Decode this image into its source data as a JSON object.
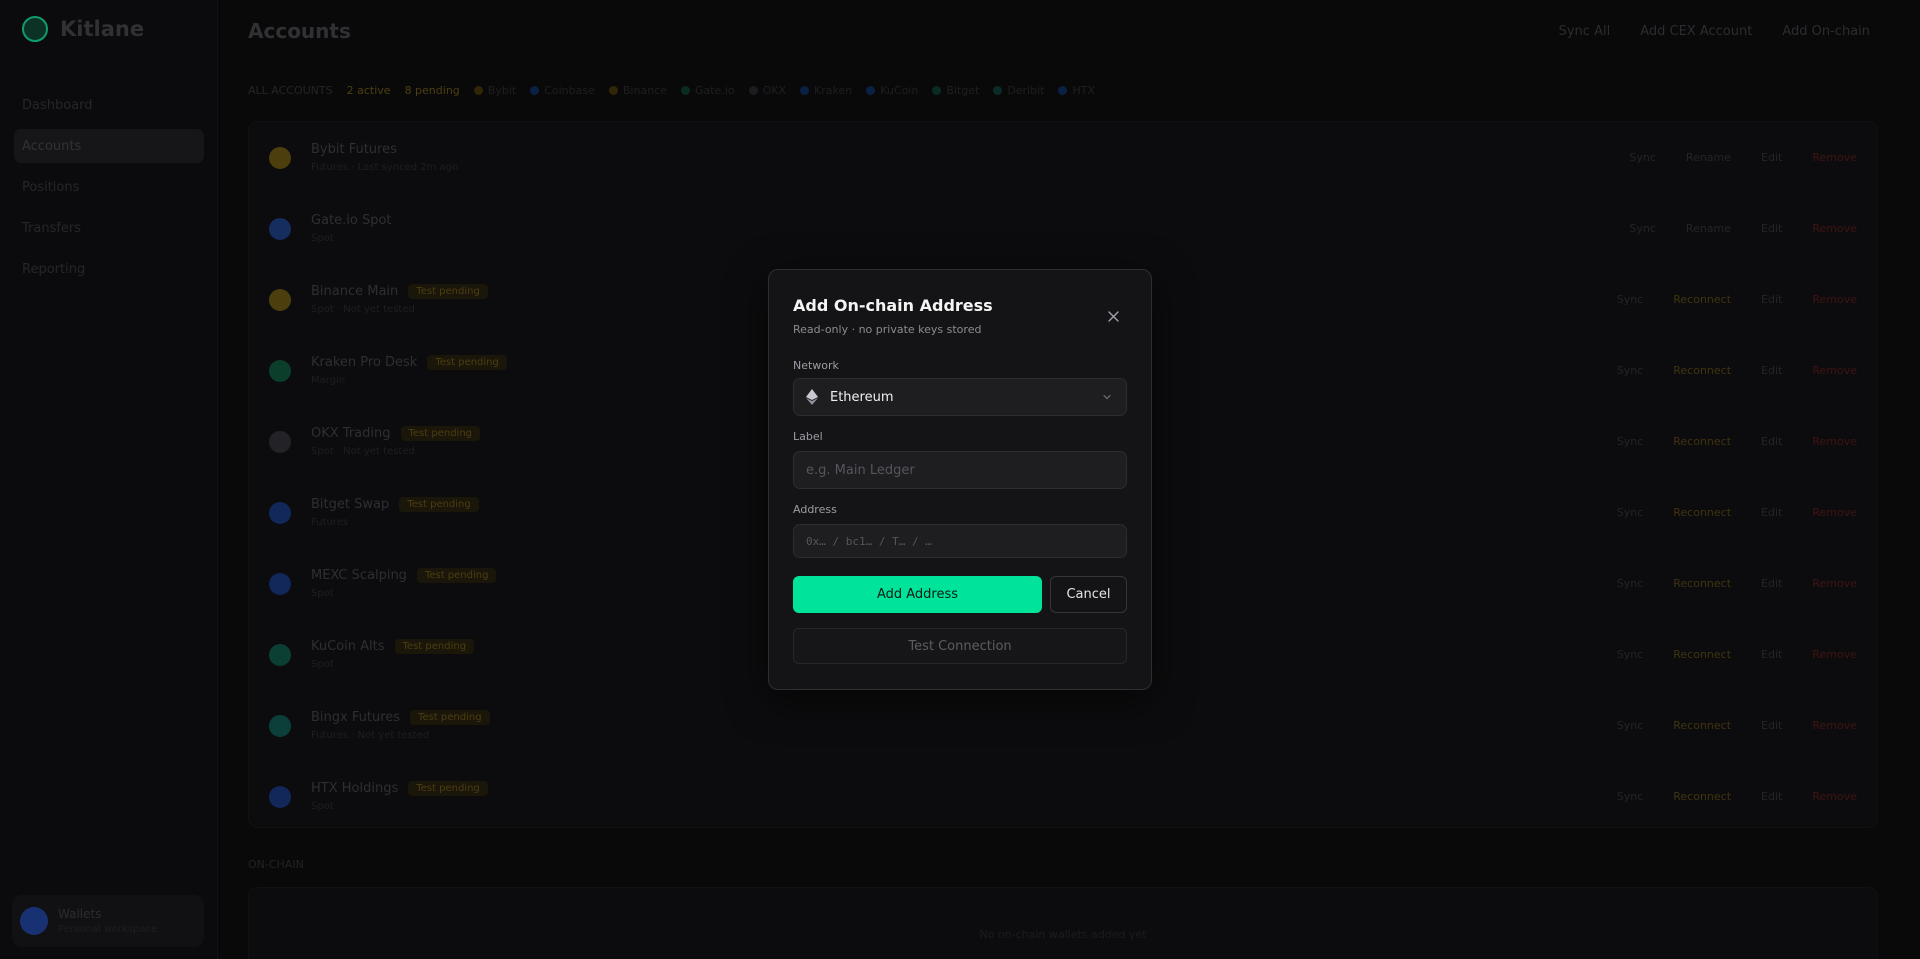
{
  "app": {
    "brand": "Kitlane",
    "page_title": "Accounts"
  },
  "sidebar": {
    "items": [
      {
        "label": "Dashboard",
        "active": false
      },
      {
        "label": "Accounts",
        "active": true
      },
      {
        "label": "Positions",
        "active": false
      },
      {
        "label": "Transfers",
        "active": false
      },
      {
        "label": "Reporting",
        "active": false
      }
    ],
    "user": {
      "name": "Wallets",
      "sub": "Personal workspace"
    }
  },
  "topbar": {
    "actions": [
      "Sync All",
      "Add CEX Account",
      "Add On-chain"
    ]
  },
  "filters": {
    "all": "ALL ACCOUNTS",
    "active": "2 active",
    "pending": "8 pending",
    "chips": [
      "Bybit",
      "Coinbase",
      "Binance",
      "Gate.io",
      "OKX",
      "Kraken",
      "KuCoin",
      "Bitget",
      "Deribit",
      "HTX"
    ]
  },
  "accounts": [
    {
      "name": "Bybit Futures",
      "badge": "",
      "sub": "Futures · Last synced 2m ago",
      "actions": [
        "Sync",
        "Rename",
        "Edit",
        "Remove"
      ],
      "color": "#5a4a10"
    },
    {
      "name": "Gate.io Spot",
      "badge": "",
      "sub": "Spot",
      "actions": [
        "Sync",
        "Rename",
        "Edit",
        "Remove"
      ],
      "color": "#1a3570"
    },
    {
      "name": "Binance Main",
      "badge": "Test pending",
      "sub": "Spot · Not yet tested",
      "actions": [
        "Sync",
        "Reconnect",
        "Edit",
        "Remove"
      ],
      "color": "#5a4a10"
    },
    {
      "name": "Kraken Pro Desk",
      "badge": "Test pending",
      "sub": "Margin",
      "actions": [
        "Sync",
        "Reconnect",
        "Edit",
        "Remove"
      ],
      "color": "#0f4a33"
    },
    {
      "name": "OKX Trading",
      "badge": "Test pending",
      "sub": "Spot · Not yet tested",
      "actions": [
        "Sync",
        "Reconnect",
        "Edit",
        "Remove"
      ],
      "color": "#2a2a2e"
    },
    {
      "name": "Bitget Swap",
      "badge": "Test pending",
      "sub": "Futures",
      "actions": [
        "Sync",
        "Reconnect",
        "Edit",
        "Remove"
      ],
      "color": "#16306a"
    },
    {
      "name": "MEXC Scalping",
      "badge": "Test pending",
      "sub": "Spot",
      "actions": [
        "Sync",
        "Reconnect",
        "Edit",
        "Remove"
      ],
      "color": "#16306a"
    },
    {
      "name": "KuCoin Alts",
      "badge": "Test pending",
      "sub": "Spot",
      "actions": [
        "Sync",
        "Reconnect",
        "Edit",
        "Remove"
      ],
      "color": "#0f4a3e"
    },
    {
      "name": "Bingx Futures",
      "badge": "Test pending",
      "sub": "Futures · Not yet tested",
      "actions": [
        "Sync",
        "Reconnect",
        "Edit",
        "Remove"
      ],
      "color": "#0f4a44"
    },
    {
      "name": "HTX Holdings",
      "badge": "Test pending",
      "sub": "Spot",
      "actions": [
        "Sync",
        "Reconnect",
        "Edit",
        "Remove"
      ],
      "color": "#16306a"
    }
  ],
  "wallets": {
    "title": "ON-CHAIN",
    "empty": "No on-chain wallets added yet"
  },
  "modal": {
    "title": "Add On-chain Address",
    "subtitle": "Read-only · no private keys stored",
    "network_label": "Network",
    "network_value": "Ethereum",
    "label_label": "Label",
    "label_placeholder": "e.g. Main Ledger",
    "address_label": "Address",
    "address_placeholder": "0x… / bc1… / T… / …",
    "add_button": "Add Address",
    "cancel_button": "Cancel",
    "test_button": "Test Connection"
  },
  "colors": {
    "accent": "#00e39a",
    "modal_bg": "#141416",
    "page_bg": "#0b0b0c"
  }
}
